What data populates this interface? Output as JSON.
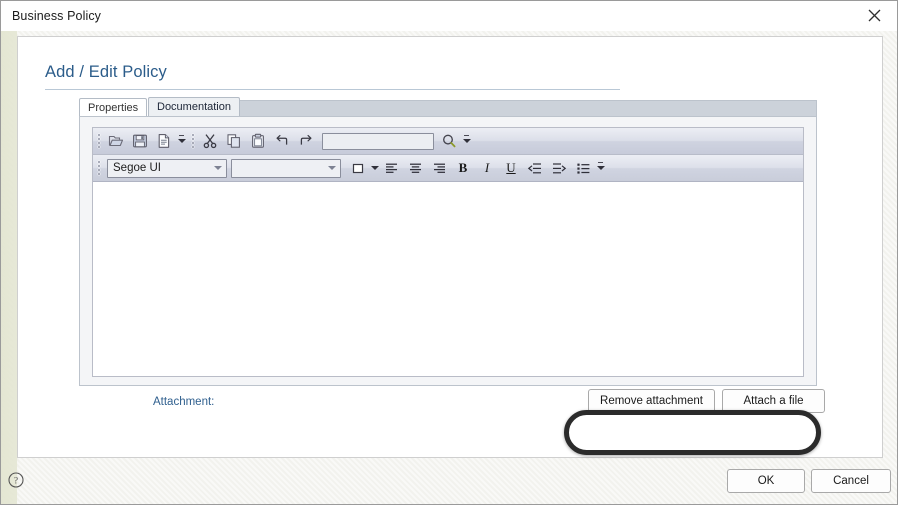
{
  "window": {
    "title": "Business Policy",
    "close_icon": "close-x-icon"
  },
  "page": {
    "heading": "Add / Edit Policy",
    "accent_color": "#2b5c8a"
  },
  "tabs": [
    {
      "label": "Properties",
      "active": false
    },
    {
      "label": "Documentation",
      "active": true
    }
  ],
  "editor": {
    "toolbar_row1": [
      {
        "name": "open-folder-icon",
        "tooltip": "Open"
      },
      {
        "name": "save-disk-icon",
        "tooltip": "Save"
      },
      {
        "name": "new-document-icon",
        "tooltip": "New"
      },
      {
        "name": "cut-scissors-icon",
        "tooltip": "Cut"
      },
      {
        "name": "copy-icon",
        "tooltip": "Copy"
      },
      {
        "name": "paste-clipboard-icon",
        "tooltip": "Paste"
      },
      {
        "name": "undo-arrow-icon",
        "tooltip": "Undo"
      },
      {
        "name": "redo-arrow-icon",
        "tooltip": "Redo"
      },
      {
        "name": "search-magnifier-icon",
        "tooltip": "Find"
      }
    ],
    "search": {
      "value": "",
      "placeholder": ""
    },
    "font_family": {
      "value": "Segoe UI"
    },
    "font_size": {
      "value": ""
    },
    "toolbar_row2": [
      {
        "name": "text-color-swatch-icon",
        "tooltip": "Text color"
      },
      {
        "name": "align-left-icon",
        "tooltip": "Align left"
      },
      {
        "name": "align-center-icon",
        "tooltip": "Align center"
      },
      {
        "name": "align-right-icon",
        "tooltip": "Align right"
      },
      {
        "name": "bold-icon",
        "label": "B",
        "tooltip": "Bold"
      },
      {
        "name": "italic-icon",
        "label": "I",
        "tooltip": "Italic"
      },
      {
        "name": "underline-icon",
        "label": "U",
        "tooltip": "Underline"
      },
      {
        "name": "decrease-indent-icon",
        "tooltip": "Decrease indent"
      },
      {
        "name": "increase-indent-icon",
        "tooltip": "Increase indent"
      },
      {
        "name": "bulleted-list-icon",
        "tooltip": "Bulleted list"
      }
    ],
    "body_text": ""
  },
  "attachment": {
    "label": "Attachment:",
    "remove_button": "Remove attachment",
    "attach_button": "Attach a file",
    "highlight_color": "#2b2b2b"
  },
  "footer": {
    "help_icon": "help-question-icon",
    "ok_button": "OK",
    "cancel_button": "Cancel"
  }
}
